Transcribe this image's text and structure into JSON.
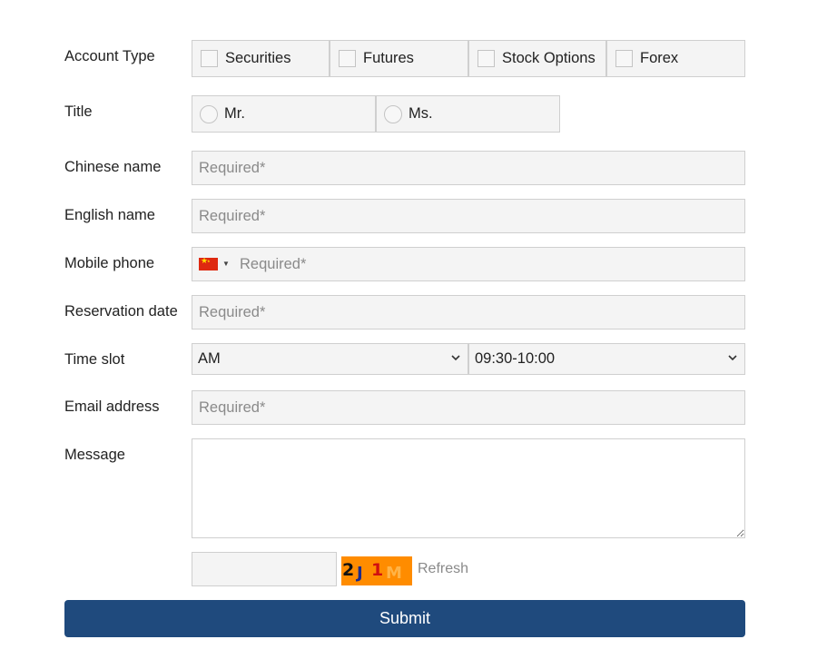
{
  "form": {
    "account_type": {
      "label": "Account Type",
      "options": [
        "Securities",
        "Futures",
        "Stock Options",
        "Forex"
      ]
    },
    "title": {
      "label": "Title",
      "options": [
        "Mr.",
        "Ms."
      ]
    },
    "chinese_name": {
      "label": "Chinese name",
      "placeholder": "Required*"
    },
    "english_name": {
      "label": "English name",
      "placeholder": "Required*"
    },
    "mobile_phone": {
      "label": "Mobile phone",
      "placeholder": "Required*",
      "country_icon": "china-flag-icon"
    },
    "reservation_date": {
      "label": "Reservation date",
      "placeholder": "Required*"
    },
    "time_slot": {
      "label": "Time slot",
      "period": "AM",
      "slot": "09:30-10:00"
    },
    "email": {
      "label": "Email address",
      "placeholder": "Required*"
    },
    "message": {
      "label": "Message"
    },
    "captcha": {
      "chars": [
        "2",
        "J",
        "1",
        "M"
      ],
      "refresh_label": "Refresh",
      "background": "#ff8c00"
    },
    "submit_label": "Submit",
    "colors": {
      "submit_bg": "#1f4a7d",
      "field_bg": "#f4f4f4",
      "border": "#cfcfcf"
    }
  }
}
